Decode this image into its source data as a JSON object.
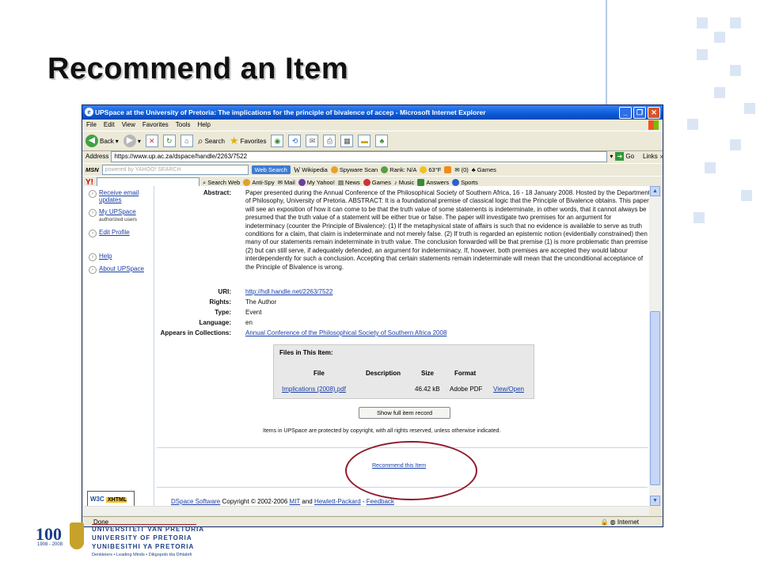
{
  "slide": {
    "title": "Recommend an Item"
  },
  "window": {
    "title": "UPSpace at the University of Pretoria: The implications for the principle of bivalence of accep - Microsoft Internet Explorer",
    "controls": [
      "_",
      "❐",
      "✕"
    ]
  },
  "menu": [
    "File",
    "Edit",
    "View",
    "Favorites",
    "Tools",
    "Help"
  ],
  "toolbar": {
    "back": "Back",
    "search": "Search",
    "favorites": "Favorites"
  },
  "address": {
    "label": "Address",
    "url": "https://www.up.ac.za/dspace/handle/2263/7522",
    "go": "Go",
    "links": "Links"
  },
  "toolbar2": {
    "field_placeholder": "powered by YAHOO! SEARCH",
    "web_search": "Web Search",
    "wikipedia": "Wikipedia",
    "spyware": "Spyware Scan",
    "rank": "Rank: N/A",
    "weather": "63°F",
    "counter": "(0)",
    "games": "Games"
  },
  "toolbar3": {
    "search_web": "Search Web",
    "anti_spy": "Anti-Spy",
    "mail": "Mail",
    "my_yahoo": "My Yahoo!",
    "news": "News",
    "games": "Games",
    "music": "Music",
    "answers": "Answers",
    "sports": "Sports"
  },
  "nav": {
    "receive": "Receive email updates",
    "myupspace": "My UPSpace",
    "authorized": "authorized users",
    "edit": "Edit Profile",
    "help": "Help",
    "about": "About UPSpace"
  },
  "item": {
    "abstract_label": "Abstract:",
    "abstract": "Paper presented during the Annual Conference of the Philosophical Society of Southern Africa, 16 - 18 January 2008. Hosted by the Department of Philosophy, University of Pretoria. ABSTRACT: It is a foundational premise of classical logic that the Principle of Bivalence obtains. This paper will see an exposition of how it can come to be that the truth value of some statements is indeterminate, in other words, that it cannot always be presumed that the truth value of a statement will be either true or false. The paper will investigate two premises for an argument for indeterminacy (counter the Principle of Bivalence): (1) If the metaphysical state of affairs is such that no evidence is available to serve as truth conditions for a claim, that claim is indeterminate and not merely false. (2) If truth is regarded an epistemic notion (evidentially constrained) then many of our statements remain indeterminate in truth value. The conclusion forwarded will be that premise (1) is more problematic than premise (2) but can still serve, if adequately defended, an argument for indeterminacy. If, however, both premises are accepted they would labour interdependently for such a conclusion. Accepting that certain statements remain indeterminate will mean that the unconditional acceptance of the Principle of Bivalence is wrong.",
    "uri_label": "URI:",
    "uri": "http://hdl.handle.net/2263/7522",
    "rights_label": "Rights:",
    "rights": "The Author",
    "type_label": "Type:",
    "type": "Event",
    "language_label": "Language:",
    "language": "en",
    "collections_label": "Appears in Collections:",
    "collection": "Annual Conference of the Philosophical Society of Southern Africa 2008"
  },
  "files": {
    "title": "Files in This Item:",
    "headers": [
      "File",
      "Description",
      "Size",
      "Format"
    ],
    "rows": [
      {
        "file": "Implications (2008).pdf",
        "description": "",
        "size": "46.42 kB",
        "format": "Adobe PDF",
        "action": "View/Open"
      }
    ]
  },
  "show_full": "Show full item record",
  "copyright_notice": "Items in UPSpace are protected by copyright, with all rights reserved, unless otherwise indicated.",
  "recommend": "Recommend this Item",
  "footer": {
    "w3c": "W3C",
    "xhtml": "XHTML 1.0",
    "dspace": "DSpace Software",
    "text1": " Copyright © 2002-2006 ",
    "mit": "MIT",
    "and": " and ",
    "hp": "Hewlett-Packard",
    "dash": " - ",
    "feedback": "Feedback"
  },
  "status": {
    "done": "Done",
    "zone": "Internet"
  },
  "university": {
    "centenary": "100",
    "years": "1908 - 2008",
    "line1": "UNIVERSITEIT VAN PRETORIA",
    "line2": "UNIVERSITY OF PRETORIA",
    "line3": "YUNIBESITHI YA PRETORIA",
    "tagline": "Denkleiers • Leading Minds • Dikgopolo tša Dihlalefi"
  },
  "colors": {
    "annotation": "#8e1c2c",
    "link": "#1a3ea6",
    "brand_blue": "#1c3f87"
  }
}
